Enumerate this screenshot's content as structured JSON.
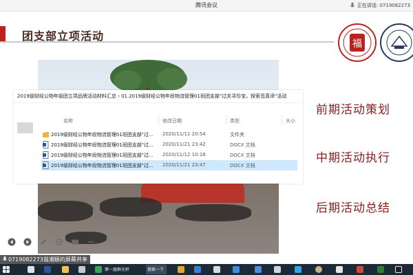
{
  "window": {
    "title": "腾讯会议",
    "speaking_label": "正在讲话: 0719082273"
  },
  "slide": {
    "title": "团支部立项活动",
    "phases": [
      "前期活动策划",
      "中期活动执行",
      "后期活动总结"
    ],
    "colors": {
      "accent": "#b8231f",
      "phase_text": "#8b1c1c",
      "title_text": "#4a2a22"
    }
  },
  "explorer": {
    "breadcrumb": "2019级财经公物年级团立项品牌活动材料汇总 › 01.2019级财经公物年段物流管理01班团支部\"过关寻珍宝，探索觅真谛\"活动",
    "columns": {
      "name": "名称",
      "modified": "修改日期",
      "type": "类型",
      "size": "大小"
    },
    "rows": [
      {
        "name": "2019级财经公物年段物流管理01班团支部\"过...",
        "modified": "2020/11/11 20:54",
        "type": "文件夹",
        "icon": "folder-icon"
      },
      {
        "name": "2019级财经公物年段物流管理01班团支部\"过...",
        "modified": "2020/11/21 23:42",
        "type": "DOCX 文档",
        "icon": "docx-icon"
      },
      {
        "name": "2019级财经公物年段物流管理01班团支部\"过...",
        "modified": "2020/11/12 10:18",
        "type": "DOCX 文档",
        "icon": "docx-icon"
      },
      {
        "name": "2019级财经公物年段物流管理01班团支部\"过...",
        "modified": "2020/11/21 23:47",
        "type": "DOCX 文档",
        "icon": "docx-icon",
        "selected": true
      }
    ]
  },
  "controls": {
    "icons": [
      "prev-slide-icon",
      "next-slide-icon",
      "pen-icon",
      "pointer-icon",
      "screen-icon",
      "more-icon"
    ]
  },
  "share": {
    "label": "0719082273翁湘颖的屏幕共享"
  },
  "taskbar": {
    "items": [
      "第一届群光杯",
      "搜索一下"
    ]
  }
}
